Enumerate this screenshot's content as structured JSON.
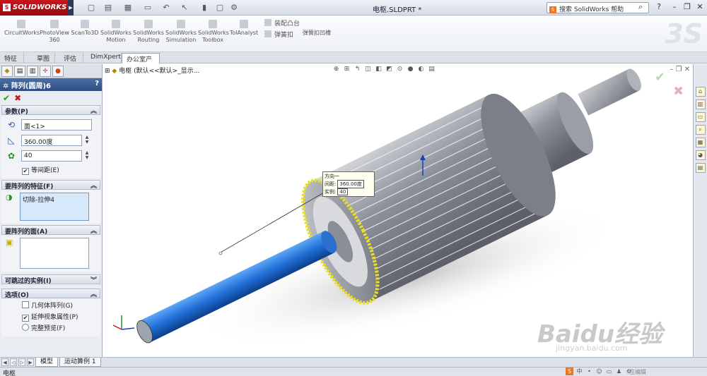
{
  "app": {
    "logo": "SOLIDWORKS",
    "doc_title": "电枢.SLDPRT *"
  },
  "search": {
    "placeholder": "搜索 SolidWorks 帮助"
  },
  "command_manager": {
    "tools": [
      {
        "label": "CircuitWorks"
      },
      {
        "label": "PhotoView 360"
      },
      {
        "label": "ScanTo3D"
      },
      {
        "label": "SolidWorks Motion"
      },
      {
        "label": "SolidWorks Routing"
      },
      {
        "label": "SolidWorks Simulation"
      },
      {
        "label": "SolidWorks Toolbox"
      },
      {
        "label": "TolAnalyst"
      }
    ],
    "small_tools": [
      "装配凸台",
      "弹簧扣",
      "弹簧扣凹槽"
    ]
  },
  "tabs": [
    "特征",
    "草图",
    "评估",
    "DimXpert",
    "办公室产品"
  ],
  "property_manager": {
    "title": "阵列(圆周)6",
    "help": "?",
    "sections": {
      "params": {
        "title": "参数(P)",
        "axis_value": "面<1>",
        "angle_value": "360.00度",
        "instances_value": "40",
        "equal_spacing_label": "等间距(E)"
      },
      "features": {
        "title": "要阵列的特征(F)",
        "item": "切除-拉伸4"
      },
      "faces": {
        "title": "要阵列的面(A)"
      },
      "skip": {
        "title": "可跳过的实例(I)"
      },
      "options": {
        "title": "选项(O)",
        "geometry_pattern": "几何体阵列(G)",
        "propagate_visual": "延伸视象属性(P)",
        "full_preview": "完整预览(F)"
      }
    }
  },
  "viewport": {
    "tree_flyout": "电枢  (默认<<默认>_显示...",
    "callout": {
      "title": "方向一",
      "spacing_label": "间距:",
      "spacing_value": "360.00度",
      "instances_label": "实例:",
      "instances_value": "40"
    },
    "colors": {
      "shaft": "#1f6fd6",
      "armature": "#8a8f99",
      "highlight": "#e8e020"
    }
  },
  "bottom_tabs": [
    "模型",
    "运动算例 1"
  ],
  "status": {
    "text": "电枢",
    "edit_label": "在编辑"
  },
  "watermark": {
    "brand": "Baidu经验",
    "url": "jingyan.baidu.com"
  }
}
